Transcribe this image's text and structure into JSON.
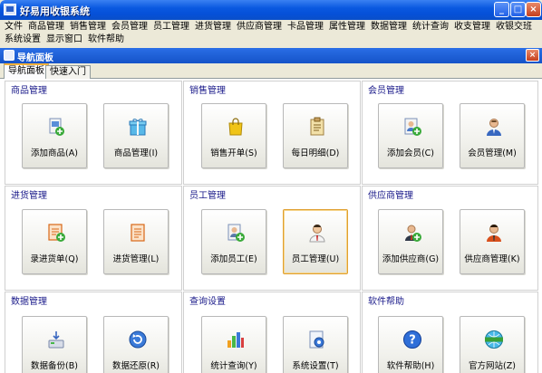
{
  "window": {
    "title": "好易用收银系统",
    "minimize": "_",
    "maximize": "□",
    "close": "×"
  },
  "menu": {
    "row1": [
      "文件",
      "商品管理",
      "销售管理",
      "会员管理",
      "员工管理",
      "进货管理",
      "供应商管理",
      "卡品管理",
      "属性管理",
      "数据管理",
      "统计查询",
      "收支管理",
      "收银交班"
    ],
    "row2": [
      "系统设置",
      "显示窗口",
      "软件帮助"
    ]
  },
  "panel": {
    "title": "导航面板",
    "close": "×"
  },
  "tabs": [
    {
      "label": "导航面板",
      "active": true
    },
    {
      "label": "快速入门",
      "active": false
    }
  ],
  "groups": [
    {
      "title": "商品管理",
      "tiles": [
        {
          "label": "添加商品(A)",
          "icon": "add-product-icon"
        },
        {
          "label": "商品管理(I)",
          "icon": "gift-icon"
        }
      ]
    },
    {
      "title": "销售管理",
      "tiles": [
        {
          "label": "销售开单(S)",
          "icon": "shopping-bag-icon"
        },
        {
          "label": "每日明细(D)",
          "icon": "clipboard-icon"
        }
      ]
    },
    {
      "title": "会员管理",
      "tiles": [
        {
          "label": "添加会员(C)",
          "icon": "add-member-icon"
        },
        {
          "label": "会员管理(M)",
          "icon": "member-icon"
        }
      ]
    },
    {
      "title": "进货管理",
      "tiles": [
        {
          "label": "录进货单(Q)",
          "icon": "add-purchase-icon"
        },
        {
          "label": "进货管理(L)",
          "icon": "purchase-doc-icon"
        }
      ]
    },
    {
      "title": "员工管理",
      "tiles": [
        {
          "label": "添加员工(E)",
          "icon": "add-employee-icon"
        },
        {
          "label": "员工管理(U)",
          "icon": "employee-icon"
        }
      ]
    },
    {
      "title": "供应商管理",
      "tiles": [
        {
          "label": "添加供应商(G)",
          "icon": "add-supplier-icon"
        },
        {
          "label": "供应商管理(K)",
          "icon": "supplier-icon"
        }
      ]
    },
    {
      "title": "数据管理",
      "tiles": [
        {
          "label": "数据备份(B)",
          "icon": "backup-icon"
        },
        {
          "label": "数据还原(R)",
          "icon": "restore-icon"
        }
      ]
    },
    {
      "title": "查询设置",
      "tiles": [
        {
          "label": "统计查询(Y)",
          "icon": "bar-chart-icon"
        },
        {
          "label": "系统设置(T)",
          "icon": "settings-icon"
        }
      ]
    },
    {
      "title": "软件帮助",
      "tiles": [
        {
          "label": "软件帮助(H)",
          "icon": "help-icon"
        },
        {
          "label": "官方网站(Z)",
          "icon": "website-icon"
        }
      ]
    }
  ],
  "colors": {
    "titlebar": "#0a59e0",
    "panel_header": "#1553c8",
    "group_title": "#1a1a8a",
    "highlight": "#e0a030"
  }
}
